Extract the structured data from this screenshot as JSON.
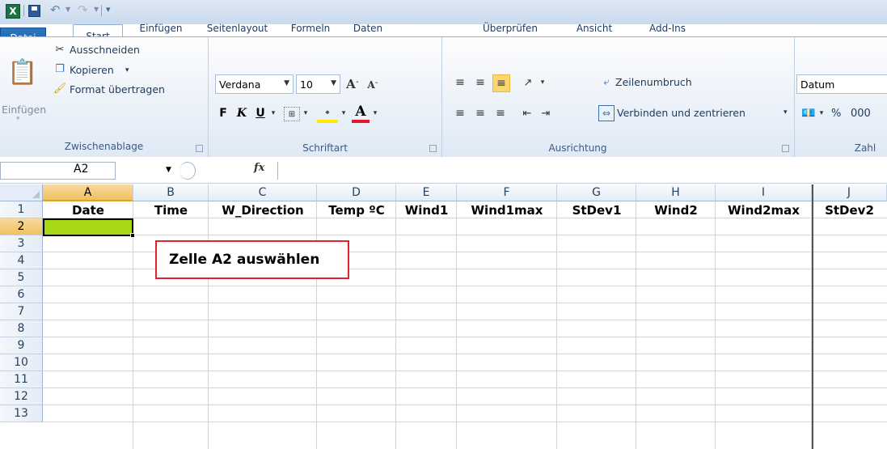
{
  "ribbon_tabs": [
    {
      "label": "Datei"
    },
    {
      "label": "Start"
    },
    {
      "label": "Einfügen"
    },
    {
      "label": "Seitenlayout"
    },
    {
      "label": "Formeln"
    },
    {
      "label": "Daten"
    },
    {
      "label": "Überprüfen"
    },
    {
      "label": "Ansicht"
    },
    {
      "label": "Add-Ins"
    }
  ],
  "clipboard": {
    "paste_label": "Einfügen",
    "cut_label": "Ausschneiden",
    "copy_label": "Kopieren",
    "format_painter_label": "Format übertragen",
    "group_label": "Zwischenablage"
  },
  "font": {
    "font_name": "Verdana",
    "font_size": "10",
    "bold": "F",
    "italic": "K",
    "underline": "U",
    "group_label": "Schriftart"
  },
  "alignment": {
    "wrap_text_label": "Zeilenumbruch",
    "merge_center_label": "Verbinden und zentrieren",
    "group_label": "Ausrichtung"
  },
  "number": {
    "format_value": "Datum",
    "percent": "%",
    "thousands": "000",
    "group_label": "Zahl"
  },
  "formula_bar": {
    "name_box": "A2",
    "fx": "fx",
    "formula": ""
  },
  "sheet": {
    "columns": [
      "A",
      "B",
      "C",
      "D",
      "E",
      "F",
      "G",
      "H",
      "I",
      "J"
    ],
    "rows": [
      "1",
      "2",
      "3",
      "4",
      "5",
      "6",
      "7",
      "8",
      "9",
      "10",
      "11",
      "12",
      "13"
    ],
    "header_row": [
      "Date",
      "Time",
      "W_Direction",
      "Temp ºC",
      "Wind1",
      "Wind1max",
      "StDev1",
      "Wind2",
      "Wind2max",
      "StDev2"
    ],
    "selected_cell": "A2",
    "selected_fill": "#a8d814"
  },
  "annotation": {
    "text": "Zelle A2 auswählen",
    "border_color": "#e0232c"
  }
}
